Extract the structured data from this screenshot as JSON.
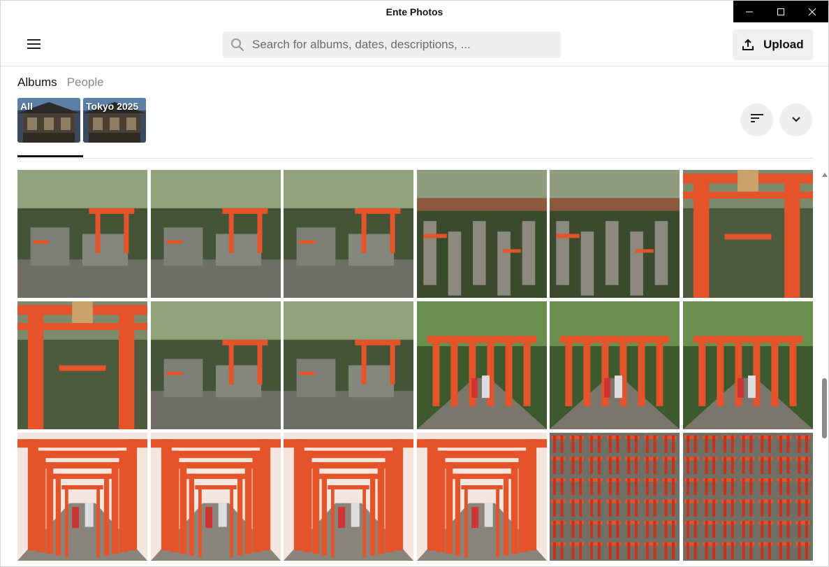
{
  "window": {
    "title": "Ente Photos"
  },
  "header": {
    "search_placeholder": "Search for albums, dates, descriptions, ...",
    "upload_label": "Upload"
  },
  "tabs": [
    {
      "label": "Albums",
      "active": true
    },
    {
      "label": "People",
      "active": false
    }
  ],
  "albums": [
    {
      "label": "All"
    },
    {
      "label": "Tokyo 2025"
    }
  ],
  "icons": {
    "menu": "hamburger-menu-icon",
    "search": "search-icon",
    "upload": "upload-icon",
    "sort": "sort-icon",
    "expand": "chevron-down-icon",
    "minimize": "minimize-icon",
    "maximize": "maximize-icon",
    "close": "close-icon"
  },
  "colors": {
    "torii_orange": "#e4532a",
    "forest_green": "#4f6b3a",
    "stone_gray": "#7d7f77"
  },
  "photos": [
    "shrine-stone-lanterns",
    "shrine-moss-gate-a",
    "shrine-moss-gate-b",
    "stone-shrines-waterfall-a",
    "stone-shrines-waterfall-b",
    "large-torii-gate-a",
    "large-torii-gate-b",
    "forest-shrine-lanterns-a",
    "forest-shrine-lanterns-b",
    "torii-tunnel-forest-a",
    "torii-tunnel-forest-b",
    "torii-tunnel-forest-c",
    "torii-corridor-walkers-a",
    "torii-corridor-walkers-b",
    "torii-corridor-walkers-c",
    "torii-path-family",
    "miniature-torii-offerings-a",
    "miniature-torii-offerings-b"
  ]
}
